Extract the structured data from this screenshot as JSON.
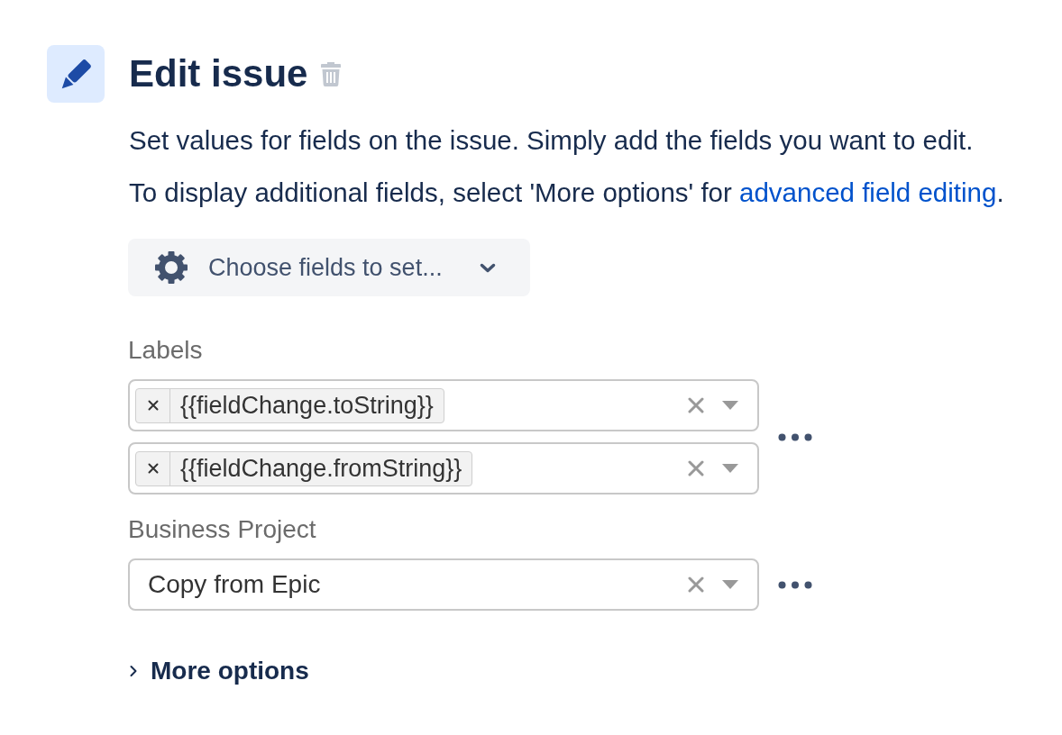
{
  "header": {
    "title": "Edit issue"
  },
  "description": [
    {
      "parts": [
        {
          "kind": "text",
          "text": "Set values for fields on the issue. Simply add the fields you want to edit."
        }
      ]
    },
    {
      "parts": [
        {
          "kind": "text",
          "text": "To display additional fields, select 'More options' for "
        },
        {
          "kind": "link",
          "text": "advanced field editing"
        },
        {
          "kind": "text",
          "text": "."
        }
      ]
    }
  ],
  "choose_fields_button": {
    "label": "Choose fields to set..."
  },
  "fields": [
    {
      "label": "Labels",
      "kind": "multi",
      "rows": [
        {
          "tags": [
            "{{fieldChange.toString}}"
          ]
        },
        {
          "tags": [
            "{{fieldChange.fromString}}"
          ]
        }
      ]
    },
    {
      "label": "Business Project",
      "kind": "single",
      "rows": [
        {
          "value": "Copy from Epic"
        }
      ]
    }
  ],
  "more_options": {
    "label": "More options",
    "expanded": false
  }
}
